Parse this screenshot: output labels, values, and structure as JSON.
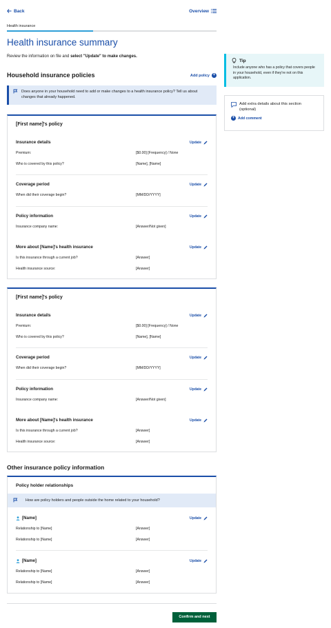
{
  "nav": {
    "back_label": "Back",
    "overview_label": "Overview"
  },
  "breadcrumb": "Health insurance",
  "progress": {
    "fraction": 0.41
  },
  "page": {
    "title": "Health insurance summary",
    "intro_prefix": "Review the information on file and ",
    "intro_bold": "select \"Update\" to make changes."
  },
  "household": {
    "title": "Household insurance policies",
    "add_policy_label": "Add policy",
    "alert_text": "Does anyone in your household need to add or make changes to a health insurance policy? Tell us about changes that already happened."
  },
  "update_label": "Update",
  "policies": [
    {
      "title": "[First name]'s policy",
      "insurance_details": {
        "heading": "Insurance details",
        "premium_label": "Premium:",
        "premium_value": "[$0.00] [Frequency] / None",
        "covered_label": "Who is covered by this policy?",
        "covered_value": "[Name], [Name]"
      },
      "coverage": {
        "heading": "Coverage period",
        "label": "When did their coverage begin?",
        "value": "[MM/DD/YYYY]"
      },
      "policy_info": {
        "heading": "Policy information",
        "label": "Insurance company name:",
        "value": "[Answer/Not given]"
      },
      "more": {
        "heading": "More about [Name]'s health insurance",
        "job_label": "Is this insurance through a current job?",
        "job_value": "[Answer]",
        "source_label": "Health insurance source:",
        "source_value": "[Answer]"
      }
    },
    {
      "title": "[First name]'s policy",
      "insurance_details": {
        "heading": "Insurance details",
        "premium_label": "Premium:",
        "premium_value": "[$0.00] [Frequency] / None",
        "covered_label": "Who is covered by this policy?",
        "covered_value": "[Name], [Name]"
      },
      "coverage": {
        "heading": "Coverage period",
        "label": "When did their coverage begin?",
        "value": "[MM/DD/YYYY]"
      },
      "policy_info": {
        "heading": "Policy information",
        "label": "Insurance company name:",
        "value": "[Answer/Not given]"
      },
      "more": {
        "heading": "More about [Name]'s health insurance",
        "job_label": "Is this insurance through a current job?",
        "job_value": "[Answer]",
        "source_label": "Health insurance source:",
        "source_value": "[Answer]"
      }
    }
  ],
  "other": {
    "title": "Other insurance policy information",
    "relationships_title": "Policy holder relationships",
    "alert_text": "How are policy holders and people outside the home related to your household?",
    "people": [
      {
        "name": "[Name]",
        "rel1_label": "Relationship to [Name]",
        "rel1_value": "[Answer]",
        "rel2_label": "Relationship to [Name]",
        "rel2_value": "[Answer]"
      },
      {
        "name": "[Name]",
        "rel1_label": "Relationship to [Name]",
        "rel1_value": "[Answer]",
        "rel2_label": "Relationship to [Name]",
        "rel2_value": "[Answer]"
      }
    ]
  },
  "confirm_label": "Confirm and next",
  "tip": {
    "title": "Tip",
    "text": "Include anyone who has a policy that covers people in your household, even if they're not on this application."
  },
  "note": {
    "text": "Add extra details about this section (optional)",
    "add_comment_label": "Add comment"
  },
  "colors": {
    "primary": "#1a4ea8",
    "confirm": "#00603a",
    "tip_accent": "#00bde3",
    "progress": "#2e9fd8"
  }
}
